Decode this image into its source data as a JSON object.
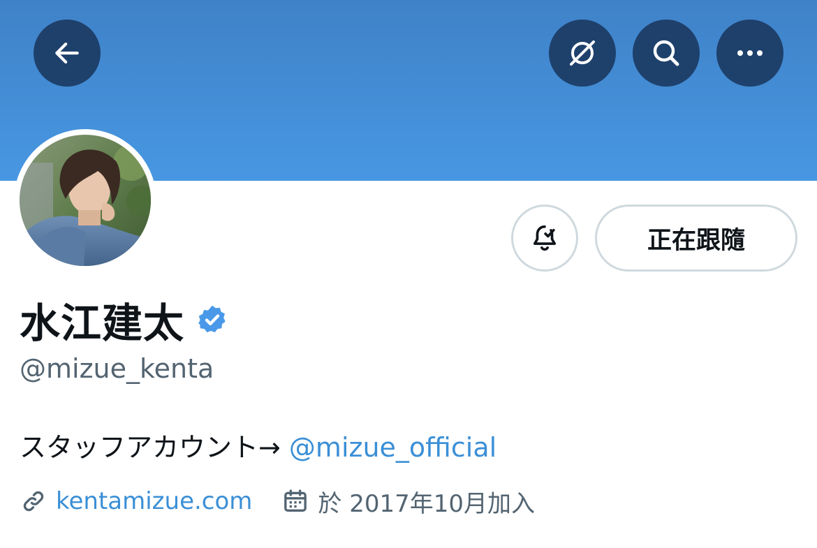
{
  "profile": {
    "display_name": "水江建太",
    "handle": "@mizue_kenta",
    "verified": true,
    "bio": {
      "text": "スタッフアカウント→ ",
      "mention": "@mizue_official"
    },
    "website": "kentamizue.com",
    "joined": "於 2017年10月加入"
  },
  "actions": {
    "follow_label": "正在跟隨"
  },
  "icons": {
    "back": "arrow-left-icon",
    "topic": "circle-slash-icon",
    "search": "search-icon",
    "more": "ellipsis-icon",
    "notify": "bell-check-icon",
    "verified": "verified-badge-icon",
    "link": "link-icon",
    "calendar": "calendar-icon"
  },
  "colors": {
    "banner": "#4897e2",
    "accent": "#3b8fd6",
    "verified": "#4a99e9",
    "text_primary": "#0f1419",
    "text_secondary": "#536471"
  }
}
